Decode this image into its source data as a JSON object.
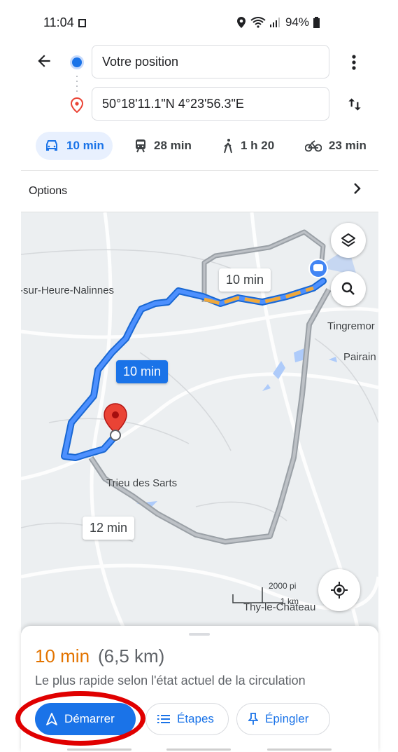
{
  "status_bar": {
    "time": "11:04",
    "battery": "94%"
  },
  "route": {
    "origin": "Votre position",
    "destination": "50°18'11.1\"N 4°23'56.3\"E"
  },
  "modes": [
    {
      "name": "car",
      "label": "10 min",
      "active": true
    },
    {
      "name": "transit",
      "label": "28 min"
    },
    {
      "name": "walk",
      "label": "1 h 20"
    },
    {
      "name": "bike",
      "label": "23 min"
    }
  ],
  "options_label": "Options",
  "map": {
    "places": [
      "-sur-Heure-Nalinnes",
      "Tingremor",
      "Pairain",
      "Trieu des Sarts",
      "Thy-le-Château"
    ],
    "route_labels": {
      "top": "10 min",
      "selected": "10 min",
      "alt": "12 min"
    },
    "scale": {
      "imperial": "2000 pi",
      "metric": "1 km"
    },
    "colors": {
      "primary_route": "#4285f4",
      "traffic": "#f0a83a",
      "alt_route": "#9aa0a6",
      "pin": "#ea4335"
    }
  },
  "sheet": {
    "duration": "10 min",
    "distance": "(6,5 km)",
    "description": "Le plus rapide selon l'état actuel de la circulation",
    "buttons": {
      "start": "Démarrer",
      "steps": "Étapes",
      "pin": "Épingler"
    }
  },
  "colors": {
    "accent": "#1a73e8",
    "duration": "#e37400",
    "highlight_ring": "#e00000"
  }
}
